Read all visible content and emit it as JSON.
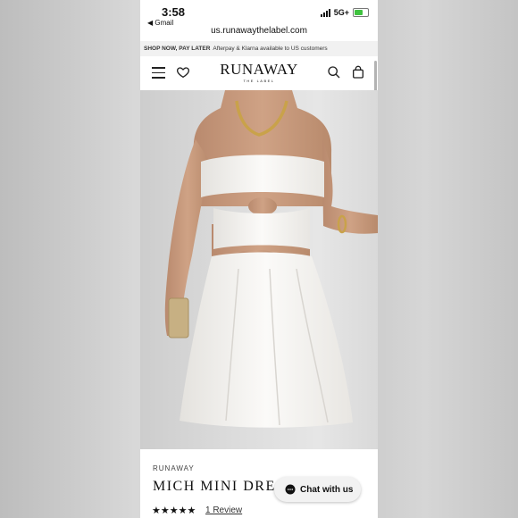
{
  "status_bar": {
    "time": "3:58",
    "back_app": "◀ Gmail",
    "network": "5G+"
  },
  "browser": {
    "url": "us.runawaythelabel.com"
  },
  "promo_banner": {
    "bold": "SHOP NOW, PAY LATER",
    "text": "Afterpay & Klarna available to US customers"
  },
  "header": {
    "logo_main": "RUNAWAY",
    "logo_sub": "THE LABEL"
  },
  "product": {
    "brand": "RUNAWAY",
    "title": "MICH MINI DRES",
    "stars": "★★★★★",
    "rating": 5,
    "review_link": "1 Review"
  },
  "chat": {
    "label": "Chat with us"
  },
  "colors": {
    "accent": "#111111",
    "battery": "#3fc23f",
    "promo_bg": "#f1f1f1"
  }
}
